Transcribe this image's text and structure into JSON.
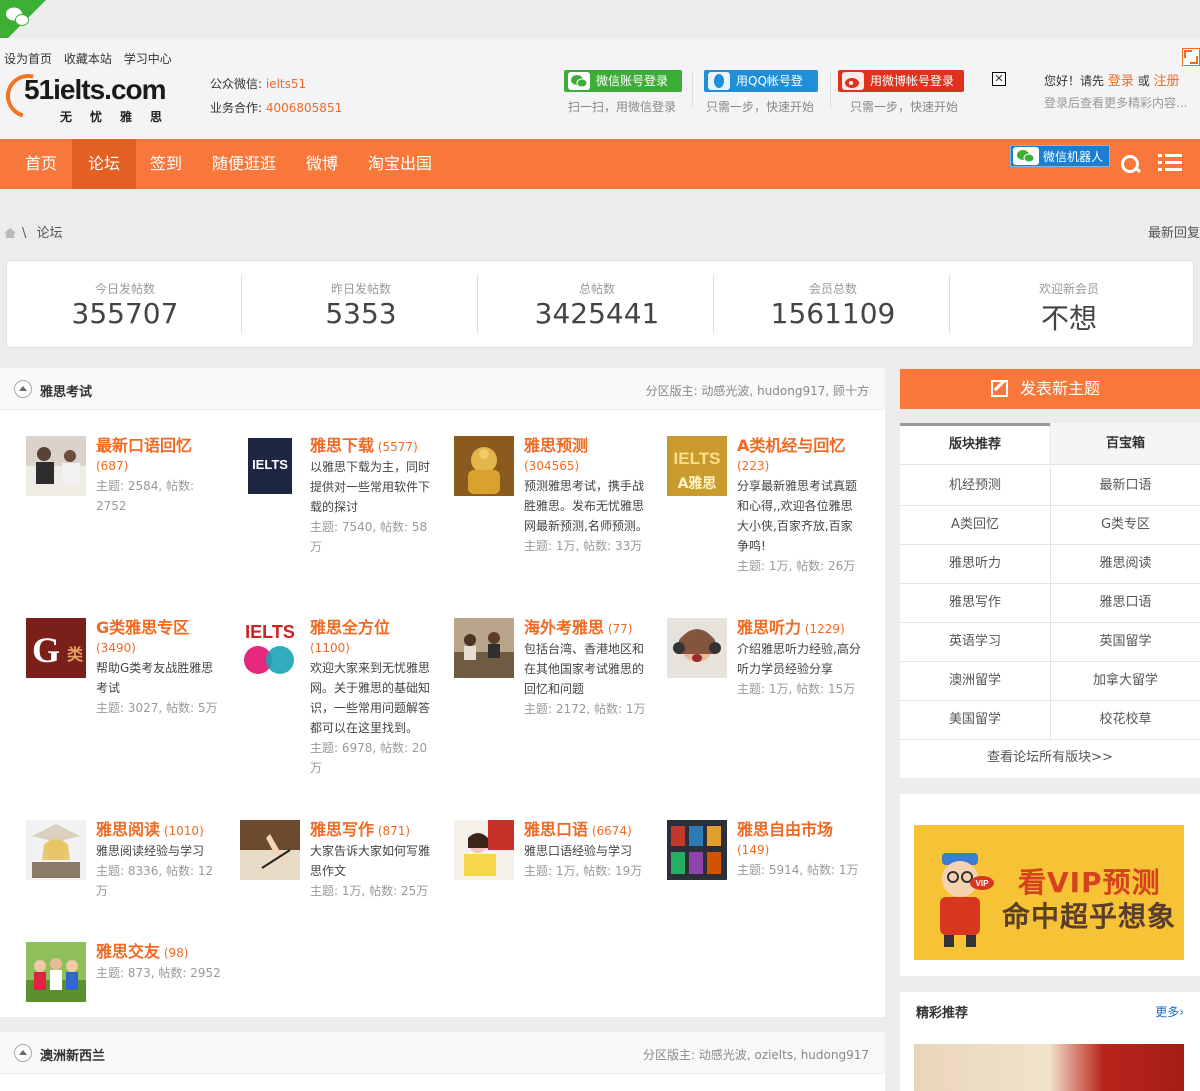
{
  "header": {
    "quick_links": [
      "设为首页",
      "收藏本站",
      "学习中心"
    ],
    "logo_main": "51ielts.com",
    "logo_sub": "无忧雅思",
    "wechat_label": "公众微信: ",
    "wechat_value": "ielts51",
    "biz_label": "业务合作: ",
    "biz_value": "4006805851",
    "login_wechat": "微信账号登录",
    "login_wechat_sub": "扫一扫，用微信登录",
    "login_qq": "用QQ帐号登录",
    "login_qq_sub": "只需一步，快速开始",
    "login_weibo": "用微博帐号登录",
    "login_weibo_sub": "只需一步，快速开始",
    "close_glyph": "✕",
    "greet_prefix": "您好！请先",
    "login_link": "登录",
    "or": "或",
    "register_link": "注册",
    "greet_sub": "登录后查看更多精彩内容..."
  },
  "nav": {
    "items": [
      "首页",
      "论坛",
      "签到",
      "随便逛逛",
      "微博",
      "淘宝出国"
    ],
    "active": "论坛",
    "wx_robot": "微信机器人"
  },
  "breadcrumb": {
    "sep": "\\",
    "current": "论坛",
    "latest": "最新回复"
  },
  "stats": [
    {
      "label": "今日发帖数",
      "value": "355707"
    },
    {
      "label": "昨日发帖数",
      "value": "5353"
    },
    {
      "label": "总帖数",
      "value": "3425441"
    },
    {
      "label": "会员总数",
      "value": "1561109"
    },
    {
      "label": "欢迎新会员",
      "value": "不想"
    }
  ],
  "section": {
    "title": "雅思考试",
    "mods": "分区版主: 动感光波, hudong917, 顾十方",
    "forums": [
      {
        "name": "最新口语回忆",
        "count": "(687)",
        "desc": "",
        "stat": "主题: 2584, 帖数: 2752"
      },
      {
        "name": "雅思下载",
        "count": "(5577)",
        "desc": "以雅思下载为主，同时提供对一些常用软件下载的探讨",
        "stat": "主题: 7540, 帖数: 58万"
      },
      {
        "name": "雅思预测",
        "count": "(304565)",
        "desc": "预测雅思考试，携手战胜雅思。发布无忧雅思网最新预测,名师预测。",
        "stat": "主题: 1万, 帖数: 33万"
      },
      {
        "name": "A类机经与回忆",
        "count": "(223)",
        "desc": "分享最新雅思考试真题和心得,,欢迎各位雅思大小侠,百家齐放,百家争鸣!",
        "stat": "主题: 1万, 帖数: 26万"
      },
      {
        "name": "G类雅思专区",
        "count": "(3490)",
        "desc": "帮助G类考友战胜雅思考试",
        "stat": "主题: 3027, 帖数: 5万"
      },
      {
        "name": "雅思全方位",
        "count": "(1100)",
        "desc": "欢迎大家来到无忧雅思网。关于雅思的基础知识，一些常用问题解答都可以在这里找到。",
        "stat": "主题: 6978, 帖数: 20万"
      },
      {
        "name": "海外考雅思",
        "count": "(77)",
        "desc": "包括台湾、香港地区和在其他国家考试雅思的回忆和问题",
        "stat": "主题: 2172, 帖数: 1万"
      },
      {
        "name": "雅思听力",
        "count": "(1229)",
        "desc": "介绍雅思听力经验,高分听力学员经验分享",
        "stat": "主题: 1万, 帖数: 15万"
      },
      {
        "name": "雅思阅读",
        "count": "(1010)",
        "desc": "雅思阅读经验与学习",
        "stat": "主题: 8336, 帖数: 12万"
      },
      {
        "name": "雅思写作",
        "count": "(871)",
        "desc": "大家告诉大家如何写雅思作文",
        "stat": "主题: 1万, 帖数: 25万"
      },
      {
        "name": "雅思口语",
        "count": "(6674)",
        "desc": "雅思口语经验与学习",
        "stat": "主题: 1万, 帖数: 19万"
      },
      {
        "name": "雅思自由市场",
        "count": "(149)",
        "desc": "",
        "stat": "主题: 5914, 帖数: 1万"
      },
      {
        "name": "雅思交友",
        "count": "(98)",
        "desc": "",
        "stat": "主题: 873, 帖数: 2952"
      }
    ]
  },
  "section2": {
    "title": "澳洲新西兰",
    "mods": "分区版主: 动感光波, ozielts, hudong917"
  },
  "sidebar": {
    "post_button": "发表新主题",
    "tab_recommend": "版块推荐",
    "tab_treasure": "百宝箱",
    "cells": [
      "机经预测",
      "最新口语",
      "A类回忆",
      "G类专区",
      "雅思听力",
      "雅思阅读",
      "雅思写作",
      "雅思口语",
      "英语学习",
      "英国留学",
      "澳洲留学",
      "加拿大留学",
      "美国留学",
      "校花校草"
    ],
    "view_all": "查看论坛所有版块>>",
    "ad_line1": "看VIP预测",
    "ad_line2": "命中超乎想象",
    "ad_badge": "VIP",
    "rec_title": "精彩推荐",
    "rec_more": "更多›"
  },
  "colors": {
    "accent": "#f7783a",
    "accent_dark": "#e35f22",
    "link_orange": "#f26a21"
  }
}
